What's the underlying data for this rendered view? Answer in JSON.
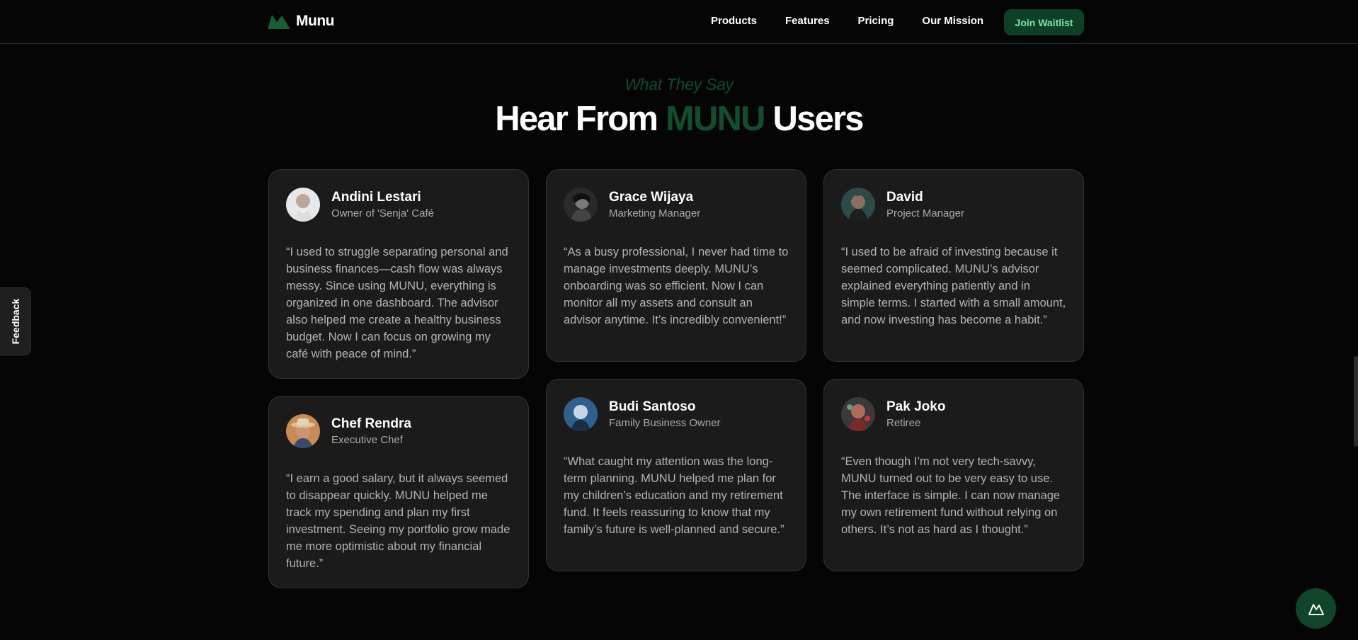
{
  "brand": {
    "name": "Munu",
    "logo_icon": "mountain-logo-icon",
    "accent": "#1a5c36"
  },
  "nav": {
    "items": [
      {
        "label": "Products"
      },
      {
        "label": "Features"
      },
      {
        "label": "Pricing"
      },
      {
        "label": "Our Mission"
      }
    ],
    "cta_label": "Join Waitlist"
  },
  "section": {
    "eyebrow": "What They Say",
    "title_before": "Hear From ",
    "title_accent": "MUNU",
    "title_after": " Users"
  },
  "testimonials": [
    {
      "name": "Andini Lestari",
      "role": "Owner of 'Senja' Café",
      "quote": "“I used to struggle separating personal and business finances—cash flow was always messy. Since using MUNU, everything is organized in one dashboard. The advisor also helped me create a healthy business budget. Now I can focus on growing my café with peace of mind.”"
    },
    {
      "name": "Grace Wijaya",
      "role": "Marketing Manager",
      "quote": "“As a busy professional, I never had time to manage investments deeply. MUNU’s onboarding was so efficient. Now I can monitor all my assets and consult an advisor anytime. It’s incredibly convenient!”"
    },
    {
      "name": "David",
      "role": "Project Manager",
      "quote": "“I used to be afraid of investing because it seemed complicated. MUNU’s advisor explained everything patiently and in simple terms. I started with a small amount, and now investing has become a habit.”"
    },
    {
      "name": "Chef Rendra",
      "role": "Executive Chef",
      "quote": "“I earn a good salary, but it always seemed to disappear quickly. MUNU helped me track my spending and plan my first investment. Seeing my portfolio grow made me more optimistic about my financial future.”"
    },
    {
      "name": "Budi Santoso",
      "role": "Family Business Owner",
      "quote": "“What caught my attention was the long-term planning. MUNU helped me plan for my children’s education and my retirement fund. It feels reassuring to know that my family’s future is well-planned and secure.”"
    },
    {
      "name": "Pak Joko",
      "role": "Retiree",
      "quote": "“Even though I’m not very tech-savvy, MUNU turned out to be very easy to use. The interface is simple. I can now manage my own retirement fund without relying on others. It’s not as hard as I thought.”"
    }
  ],
  "feedback_label": "Feedback",
  "chat_button_icon": "mountain-chat-icon"
}
